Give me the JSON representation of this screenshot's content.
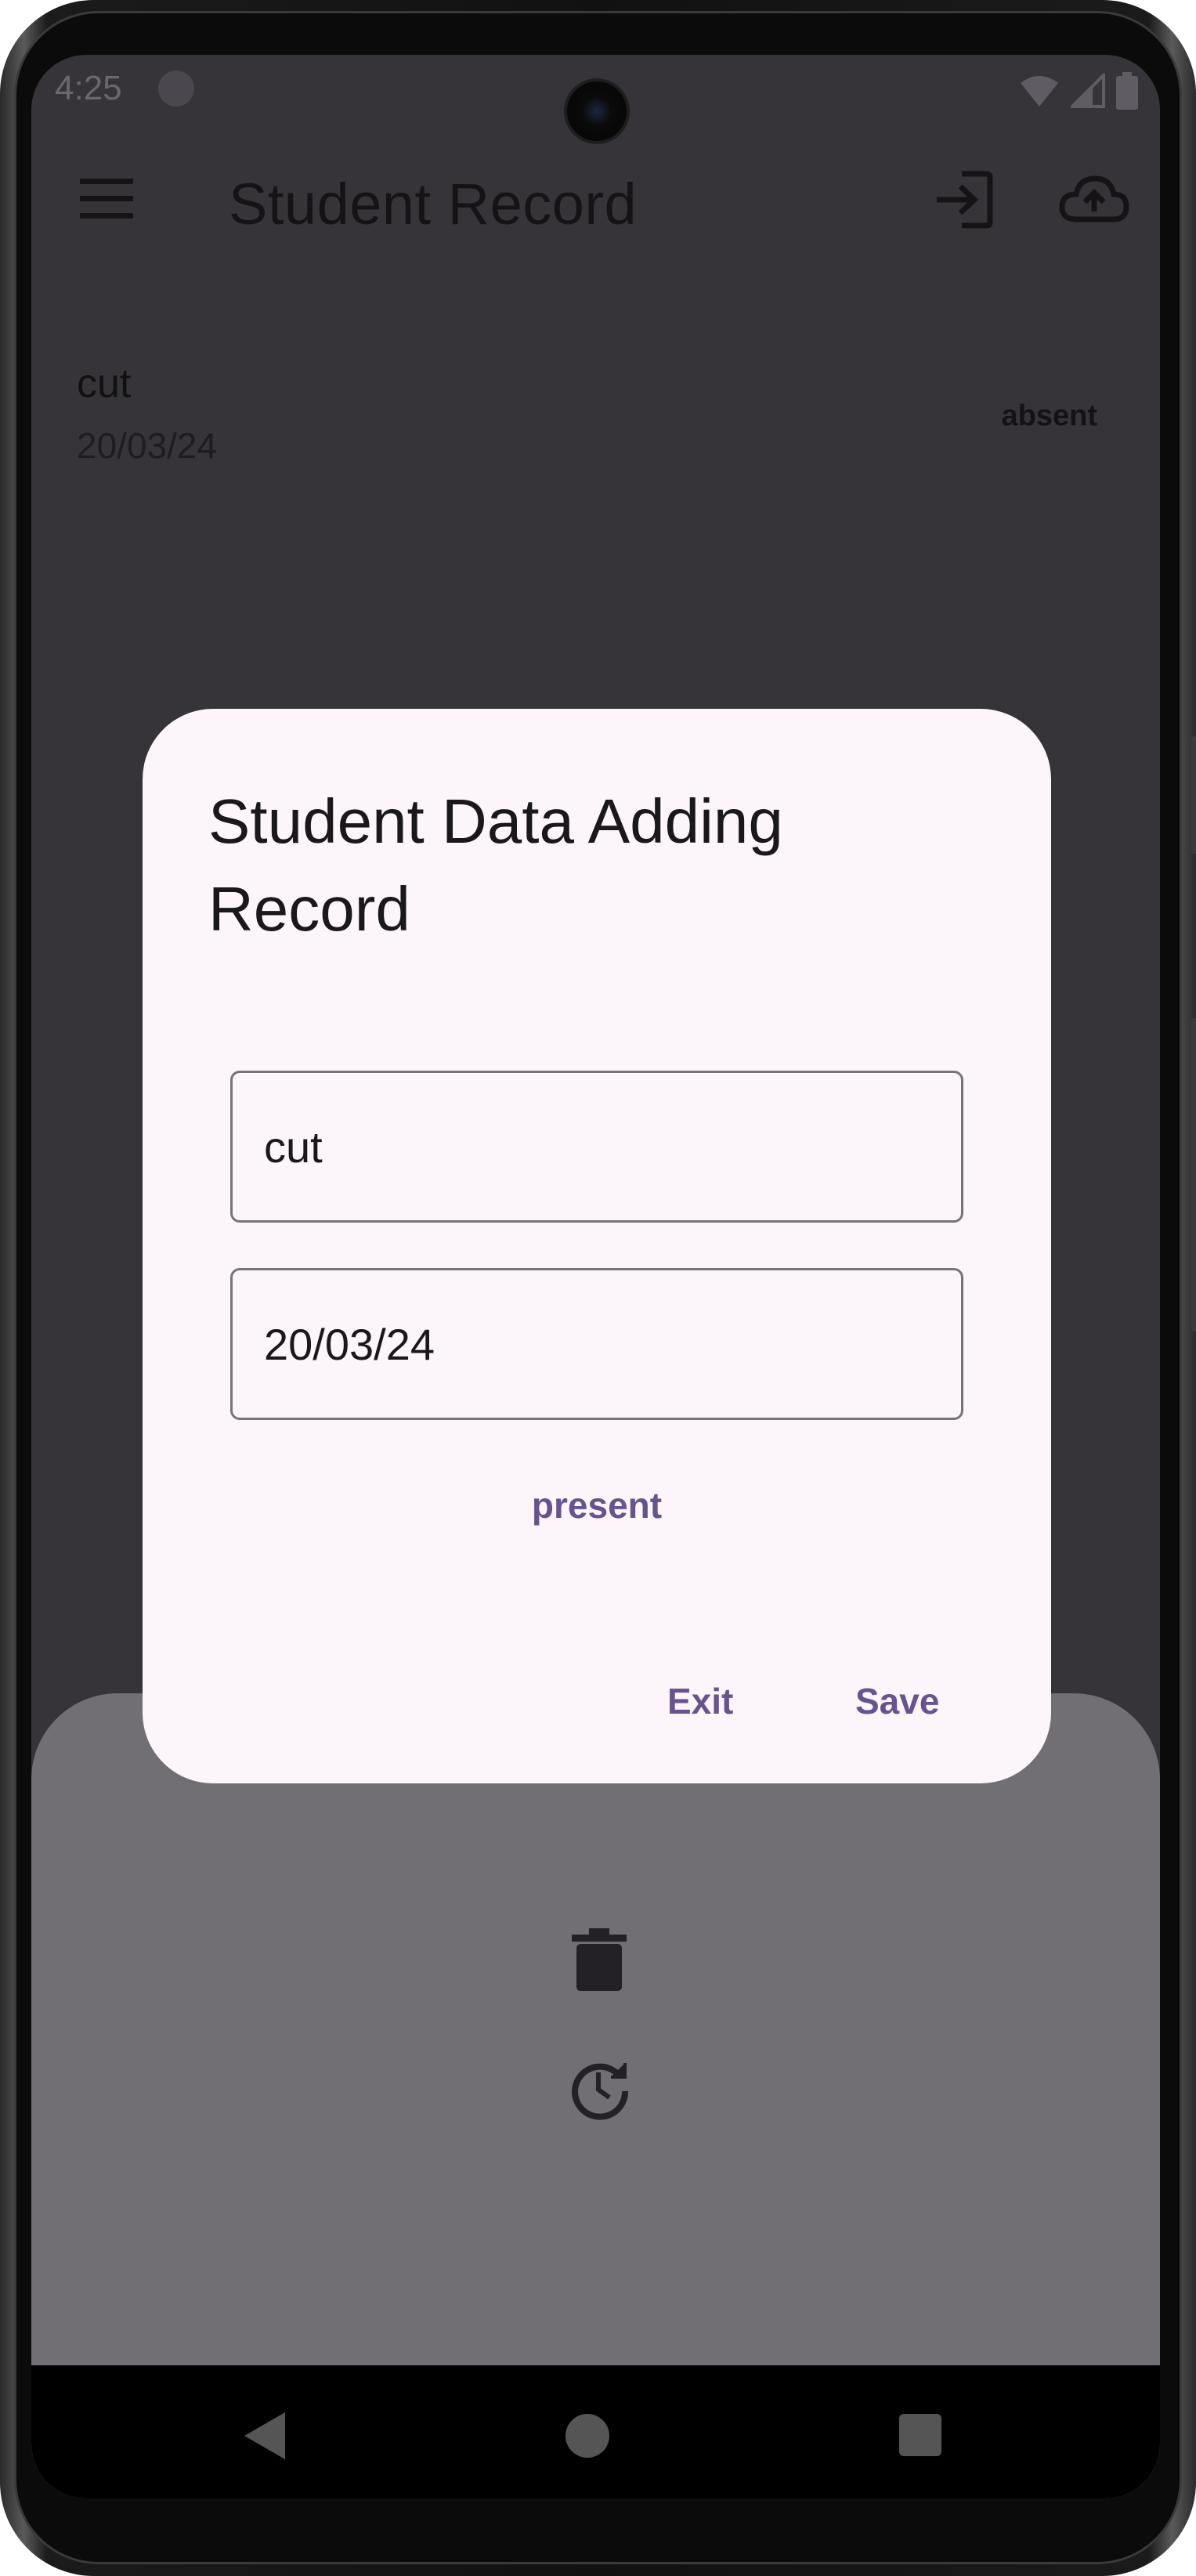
{
  "status_bar": {
    "time": "4:25",
    "icons": [
      "app-notification-icon",
      "wifi-icon",
      "cellular-signal-icon",
      "battery-icon"
    ]
  },
  "app_bar": {
    "title": "Student Record",
    "icons": [
      "menu-icon",
      "login-icon",
      "cloud-upload-icon"
    ]
  },
  "records": [
    {
      "name": "cut",
      "date": "20/03/24",
      "status": "absent"
    }
  ],
  "bottom_sheet": {
    "icons": [
      "delete-icon",
      "history-icon"
    ]
  },
  "dialog": {
    "title": "Student Data Adding Record",
    "name_value": "cut",
    "date_value": "20/03/24",
    "status_toggle_label": "present",
    "exit_label": "Exit",
    "save_label": "Save"
  },
  "nav_bar": {
    "icons": [
      "back-icon",
      "home-icon",
      "recents-icon"
    ]
  },
  "colors": {
    "scrim": "#363438",
    "dialog_bg": "#fcf5fa",
    "accent": "#67548f",
    "bottom_sheet": "#716f74"
  }
}
